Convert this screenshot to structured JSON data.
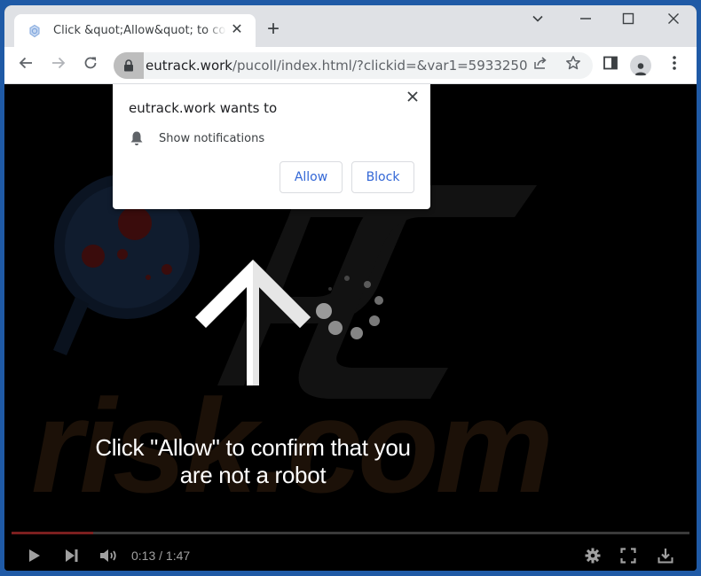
{
  "browser": {
    "tab": {
      "title": "Click &quot;Allow&quot; to confirm that you are not a robot",
      "favicon": "bell-favicon-icon"
    },
    "new_tab_icon": "plus-icon",
    "window_controls": [
      "chevron-down-icon",
      "minimize-icon",
      "maximize-icon",
      "close-icon"
    ],
    "toolbar": {
      "back_icon": "back-arrow-icon",
      "forward_icon": "forward-arrow-icon",
      "reload_icon": "reload-icon",
      "url_domain": "eutrack.work",
      "url_path": "/pucoll/index.html/?clickid=&var1=5933250",
      "share_icon": "share-icon",
      "bookmark_icon": "star-icon",
      "sidepanel_icon": "side-panel-icon",
      "profile_icon": "profile-icon",
      "menu_icon": "kebab-menu-icon"
    }
  },
  "permission_popup": {
    "title": "eutrack.work wants to",
    "permission": "Show notifications",
    "allow_label": "Allow",
    "block_label": "Block"
  },
  "page": {
    "caption_line1": "Click \"Allow\" to confirm that you",
    "caption_line2": "are not a robot",
    "watermark_text": "risk.com"
  },
  "video_player": {
    "current_time": "0:13",
    "duration": "1:47",
    "time_display": "0:13 / 1:47",
    "progress_fraction": 0.12,
    "progress_color": "#7c1f1f",
    "controls": [
      "play-icon",
      "next-icon",
      "volume-icon",
      "settings-icon",
      "fullscreen-icon",
      "download-icon"
    ]
  }
}
